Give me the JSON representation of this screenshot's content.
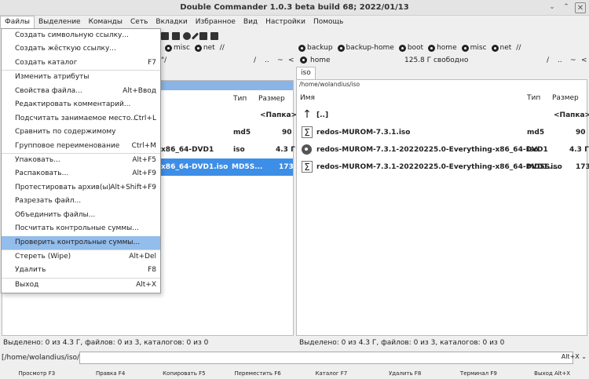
{
  "window": {
    "title": "Double Commander 1.0.3 beta build 68; 2022/01/13",
    "minimize": "⌄",
    "maximize": "⌃",
    "close": "✕"
  },
  "menubar": [
    "Файлы",
    "Выделение",
    "Команды",
    "Сеть",
    "Вкладки",
    "Избранное",
    "Вид",
    "Настройки",
    "Помощь"
  ],
  "file_menu": [
    {
      "label": "Создать символьную ссылку...",
      "shortcut": ""
    },
    {
      "label": "Создать жёсткую ссылку...",
      "shortcut": ""
    },
    {
      "label": "Создать каталог",
      "shortcut": "F7"
    },
    {
      "sep": true
    },
    {
      "label": "Изменить атрибуты",
      "shortcut": ""
    },
    {
      "label": "Свойства файла...",
      "shortcut": "Alt+Ввод"
    },
    {
      "label": "Редактировать комментарий...",
      "shortcut": ""
    },
    {
      "label": "Подсчитать занимаемое место...",
      "shortcut": "Ctrl+L"
    },
    {
      "label": "Сравнить по содержимому",
      "shortcut": ""
    },
    {
      "label": "Групповое переименование",
      "shortcut": "Ctrl+M"
    },
    {
      "sep": true
    },
    {
      "label": "Упаковать...",
      "shortcut": "Alt+F5"
    },
    {
      "label": "Распаковать...",
      "shortcut": "Alt+F9"
    },
    {
      "label": "Протестировать архив(ы)",
      "shortcut": "Alt+Shift+F9"
    },
    {
      "label": "Разрезать файл...",
      "shortcut": ""
    },
    {
      "label": "Объединить файлы...",
      "shortcut": ""
    },
    {
      "label": "Посчитать контрольные суммы...",
      "shortcut": ""
    },
    {
      "label": "Проверить контрольные суммы...",
      "shortcut": "",
      "highlighted": true
    },
    {
      "sep": true
    },
    {
      "label": "Стереть (Wipe)",
      "shortcut": "Alt+Del"
    },
    {
      "label": "Удалить",
      "shortcut": "F8"
    },
    {
      "sep": true
    },
    {
      "label": "Выход",
      "shortcut": "Alt+X"
    }
  ],
  "left_drives": [
    "misc",
    "net",
    "//"
  ],
  "left_path": "\"/",
  "left_nav": [
    "/",
    "..",
    "~",
    "<"
  ],
  "right_drives": [
    "backup",
    "backup-home",
    "boot",
    "home",
    "misc",
    "net",
    "//"
  ],
  "right_path": {
    "drive": "home",
    "free": "125.8 Г свободно",
    "nav": [
      "/",
      "..",
      "~",
      "<"
    ]
  },
  "right_tab": "iso",
  "columns": {
    "name": "Имя",
    "type": "Тип",
    "size": "Размер"
  },
  "left_panel": {
    "rows": [
      {
        "name": "",
        "type": "",
        "size": "<Папка>"
      },
      {
        "name": "",
        "type": "md5",
        "size": "90"
      },
      {
        "name": "x86_64-DVD1",
        "type": "iso",
        "size": "4.3 Г"
      },
      {
        "name": "x86_64-DVD1.iso",
        "type": "MD5S...",
        "size": "173",
        "selected": true
      }
    ]
  },
  "right_panel": {
    "path": "/home/wolandius/iso",
    "rows": [
      {
        "icon": "up-arrow-icon",
        "name": "[..]",
        "type": "",
        "size": "<Папка>"
      },
      {
        "icon": "checksum-file-icon",
        "name": "redos-MUROM-7.3.1.iso",
        "type": "md5",
        "size": "90"
      },
      {
        "icon": "disc-image-icon",
        "name": "redos-MUROM-7.3.1-20220225.0-Everything-x86_64-DVD1",
        "type": "iso",
        "size": "4.3 Г"
      },
      {
        "icon": "checksum-file-icon",
        "name": "redos-MUROM-7.3.1-20220225.0-Everything-x86_64-DVD1.iso",
        "type": "MD5S...",
        "size": "173"
      }
    ]
  },
  "status": {
    "left": "Выделено: 0 из 4.3 Г, файлов: 0 из 3, каталогов: 0 из 0",
    "right": "Выделено: 0 из 4.3 Г, файлов: 0 из 3, каталогов: 0 из 0"
  },
  "cmdline": {
    "prompt": "[/home/wolandius/iso/]$:",
    "history": "Alt+X"
  },
  "fkeys": [
    "Просмотр F3",
    "Правка F4",
    "Копировать F5",
    "Переместить F6",
    "Каталог F7",
    "Удалить F8",
    "Терминал F9",
    "Выход Alt+X"
  ]
}
